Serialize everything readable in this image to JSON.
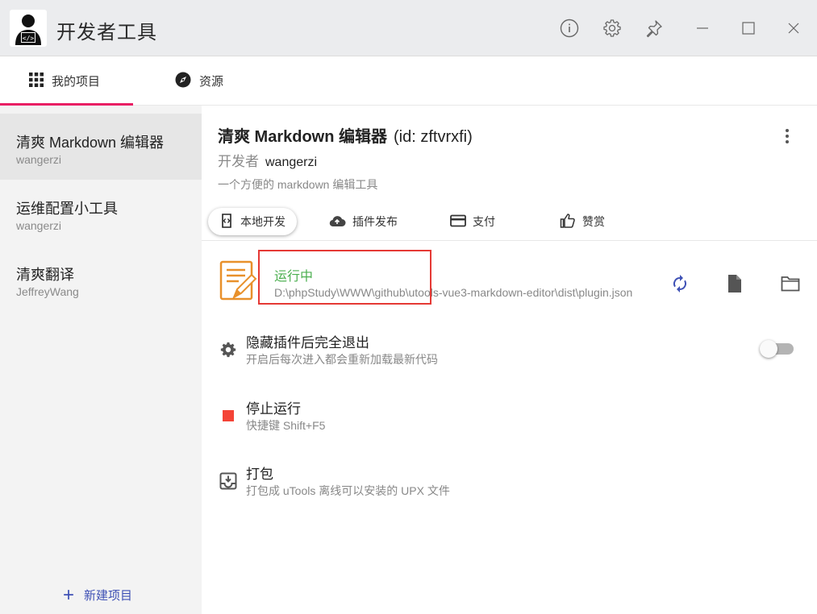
{
  "app": {
    "title": "开发者工具"
  },
  "tabs": [
    {
      "label": "我的项目",
      "icon": "grid-icon",
      "active": true
    },
    {
      "label": "资源",
      "icon": "compass-icon",
      "active": false
    }
  ],
  "sidebar": {
    "projects": [
      {
        "name": "清爽 Markdown 编辑器",
        "author": "wangerzi",
        "active": true
      },
      {
        "name": "运维配置小工具",
        "author": "wangerzi",
        "active": false
      },
      {
        "name": "清爽翻译",
        "author": "JeffreyWang",
        "active": false
      }
    ],
    "new_project_label": "新建项目"
  },
  "project": {
    "name": "清爽 Markdown 编辑器",
    "id_text": "(id: zftvrxfi)",
    "developer_label": "开发者",
    "developer": "wangerzi",
    "description": "一个方便的 markdown 编辑工具"
  },
  "subtabs": [
    {
      "label": "本地开发",
      "active": true
    },
    {
      "label": "插件发布",
      "active": false
    },
    {
      "label": "支付",
      "active": false
    },
    {
      "label": "赞赏",
      "active": false
    }
  ],
  "run": {
    "status": "运行中",
    "path": "D:\\phpStudy\\WWW\\github\\utools-vue3-markdown-editor\\dist\\plugin.json"
  },
  "options": {
    "hide_exit": {
      "title": "隐藏插件后完全退出",
      "subtitle": "开启后每次进入都会重新加载最新代码",
      "enabled": false
    },
    "stop": {
      "title": "停止运行",
      "subtitle": "快捷键 Shift+F5"
    },
    "pack": {
      "title": "打包",
      "subtitle": "打包成 uTools 离线可以安装的 UPX 文件"
    }
  },
  "colors": {
    "accent": "#e91e63",
    "running": "#4caf50",
    "primary": "#3f51b5",
    "stop": "#f44336",
    "highlight_box": "#e53935"
  }
}
